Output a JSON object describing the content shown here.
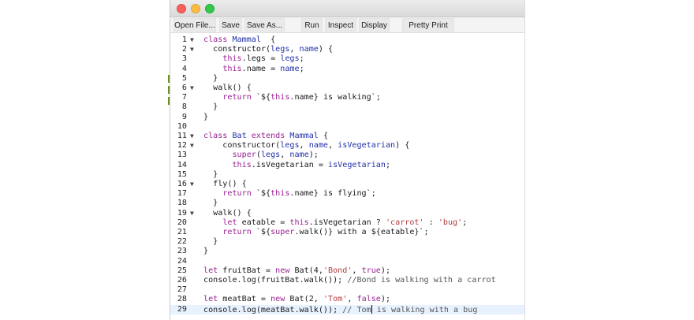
{
  "toolbar": {
    "buttons": [
      "Open File...",
      "Save",
      "Save As...",
      "Run",
      "Inspect",
      "Display",
      "Pretty Print"
    ]
  },
  "editor": {
    "fold_glyph": "▼",
    "fold_lines": [
      1,
      2,
      6,
      11,
      12,
      16,
      19
    ],
    "active_line": 29,
    "lines": [
      [
        [
          "k",
          "class "
        ],
        [
          "d",
          "Mammal"
        ],
        [
          "",
          "  {"
        ]
      ],
      [
        [
          "",
          "  constructor("
        ],
        [
          "d",
          "legs"
        ],
        [
          "",
          ", "
        ],
        [
          "d",
          "name"
        ],
        [
          "",
          ") {"
        ]
      ],
      [
        [
          "",
          "    "
        ],
        [
          "k",
          "this"
        ],
        [
          "",
          ".legs = "
        ],
        [
          "d",
          "legs"
        ],
        [
          "",
          ";"
        ]
      ],
      [
        [
          "",
          "    "
        ],
        [
          "k",
          "this"
        ],
        [
          "",
          ".name = "
        ],
        [
          "d",
          "name"
        ],
        [
          "",
          ";"
        ]
      ],
      [
        [
          "",
          "  }"
        ]
      ],
      [
        [
          "",
          "  walk() {"
        ]
      ],
      [
        [
          "",
          "    "
        ],
        [
          "k",
          "return"
        ],
        [
          "",
          " `${"
        ],
        [
          "k",
          "this"
        ],
        [
          "",
          ".name} is walking`;"
        ]
      ],
      [
        [
          "",
          "  }"
        ]
      ],
      [
        [
          "",
          "}"
        ]
      ],
      [
        [
          "",
          ""
        ]
      ],
      [
        [
          "k",
          "class "
        ],
        [
          "d",
          "Bat"
        ],
        [
          "k",
          " extends "
        ],
        [
          "d",
          "Mammal"
        ],
        [
          "",
          " {"
        ]
      ],
      [
        [
          "",
          "    constructor("
        ],
        [
          "d",
          "legs"
        ],
        [
          "",
          ", "
        ],
        [
          "d",
          "name"
        ],
        [
          "",
          ", "
        ],
        [
          "d",
          "isVegetarian"
        ],
        [
          "",
          ") {"
        ]
      ],
      [
        [
          "",
          "      "
        ],
        [
          "k",
          "super"
        ],
        [
          "",
          "("
        ],
        [
          "d",
          "legs"
        ],
        [
          "",
          ", "
        ],
        [
          "d",
          "name"
        ],
        [
          "",
          ");"
        ]
      ],
      [
        [
          "",
          "      "
        ],
        [
          "k",
          "this"
        ],
        [
          "",
          ".isVegetarian = "
        ],
        [
          "d",
          "isVegetarian"
        ],
        [
          "",
          ";"
        ]
      ],
      [
        [
          "",
          "  }"
        ]
      ],
      [
        [
          "",
          "  fly() {"
        ]
      ],
      [
        [
          "",
          "    "
        ],
        [
          "k",
          "return"
        ],
        [
          "",
          " `${"
        ],
        [
          "k",
          "this"
        ],
        [
          "",
          ".name} is flying`;"
        ]
      ],
      [
        [
          "",
          "  }"
        ]
      ],
      [
        [
          "",
          "  walk() {"
        ]
      ],
      [
        [
          "",
          "    "
        ],
        [
          "k",
          "let"
        ],
        [
          "",
          " eatable = "
        ],
        [
          "k",
          "this"
        ],
        [
          "",
          ".isVegetarian ? "
        ],
        [
          "s",
          "'carrot'"
        ],
        [
          "",
          " : "
        ],
        [
          "s",
          "'bug'"
        ],
        [
          "",
          ";"
        ]
      ],
      [
        [
          "",
          "    "
        ],
        [
          "k",
          "return"
        ],
        [
          "",
          " `${"
        ],
        [
          "k",
          "super"
        ],
        [
          "",
          ".walk()} with a ${eatable}`;"
        ]
      ],
      [
        [
          "",
          "  }"
        ]
      ],
      [
        [
          "",
          "}"
        ]
      ],
      [
        [
          "",
          ""
        ]
      ],
      [
        [
          "k",
          "let"
        ],
        [
          "",
          " fruitBat = "
        ],
        [
          "k",
          "new"
        ],
        [
          "",
          " Bat(4,"
        ],
        [
          "s",
          "'Bond'"
        ],
        [
          "",
          ", "
        ],
        [
          "k",
          "true"
        ],
        [
          "",
          ");"
        ]
      ],
      [
        [
          "",
          "console.log(fruitBat.walk()); "
        ],
        [
          "c",
          "//Bond is walking with a carrot"
        ]
      ],
      [
        [
          "",
          ""
        ]
      ],
      [
        [
          "k",
          "let"
        ],
        [
          "",
          " meatBat = "
        ],
        [
          "k",
          "new"
        ],
        [
          "",
          " Bat(2, "
        ],
        [
          "s",
          "'Tom'"
        ],
        [
          "",
          ", "
        ],
        [
          "k",
          "false"
        ],
        [
          "",
          ");"
        ]
      ],
      [
        [
          "",
          "console.log(meatBat.walk()); "
        ],
        [
          "c",
          "// Tom"
        ],
        [
          "cursor",
          ""
        ],
        [
          "c",
          " is walking with a bug"
        ]
      ]
    ]
  }
}
